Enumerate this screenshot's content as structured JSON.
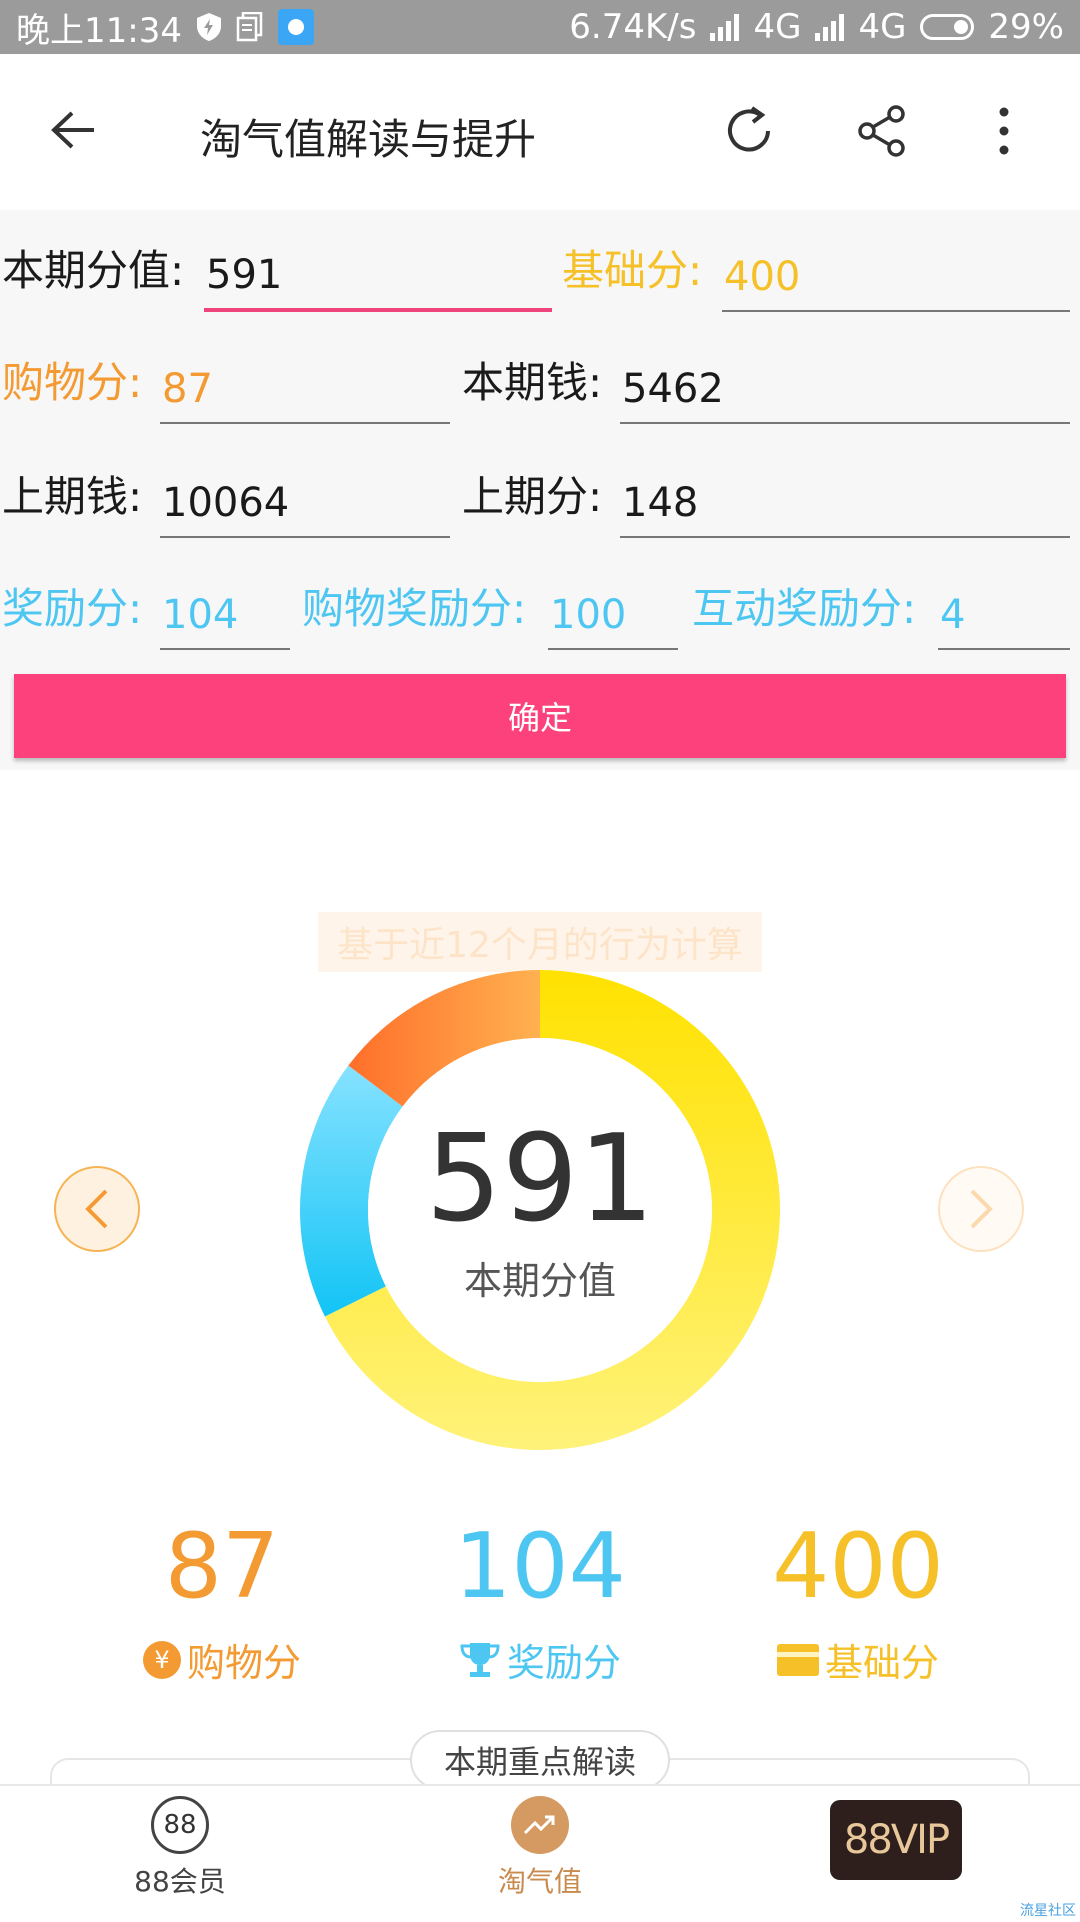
{
  "status_bar": {
    "time": "晚上11:34",
    "net_speed": "6.74K/s",
    "network_1": "4G",
    "network_2": "4G",
    "battery": "29%"
  },
  "app_bar": {
    "title": "淘气值解读与提升"
  },
  "form": {
    "current_score": {
      "label": "本期分值:",
      "value": "591"
    },
    "base_score": {
      "label": "基础分:",
      "value": "400"
    },
    "shopping_score": {
      "label": "购物分:",
      "value": "87"
    },
    "current_money": {
      "label": "本期钱:",
      "value": "5462"
    },
    "last_money": {
      "label": "上期钱:",
      "value": "10064"
    },
    "last_score": {
      "label": "上期分:",
      "value": "148"
    },
    "reward_score": {
      "label": "奖励分:",
      "value": "104"
    },
    "shopping_reward": {
      "label": "购物奖励分:",
      "value": "100"
    },
    "interaction_reward": {
      "label": "互动奖励分:",
      "value": "4"
    },
    "confirm_label": "确定"
  },
  "summary": {
    "banner": "基于近12个月的行为计算",
    "center_value": "591",
    "center_label": "本期分值"
  },
  "chart_data": {
    "type": "pie",
    "categories": [
      "基础分",
      "奖励分",
      "购物分"
    ],
    "values": [
      400,
      104,
      87
    ],
    "colors": [
      "#ffe200",
      "#30c8f5",
      "#ff8a33"
    ]
  },
  "stats": [
    {
      "value": "87",
      "label": "购物分",
      "color": "#f39a32",
      "icon": "yen-coin-icon"
    },
    {
      "value": "104",
      "label": "奖励分",
      "color": "#4ec6f2",
      "icon": "trophy-icon"
    },
    {
      "value": "400",
      "label": "基础分",
      "color": "#f5c028",
      "icon": "card-icon"
    }
  ],
  "key_section": {
    "title": "本期重点解读"
  },
  "tab_bar": {
    "tab_88": {
      "icon_text": "88",
      "label": "88会员"
    },
    "tab_taoqi": {
      "label": "淘气值"
    },
    "vip_badge": "88VIP"
  },
  "watermark": "流星社区"
}
